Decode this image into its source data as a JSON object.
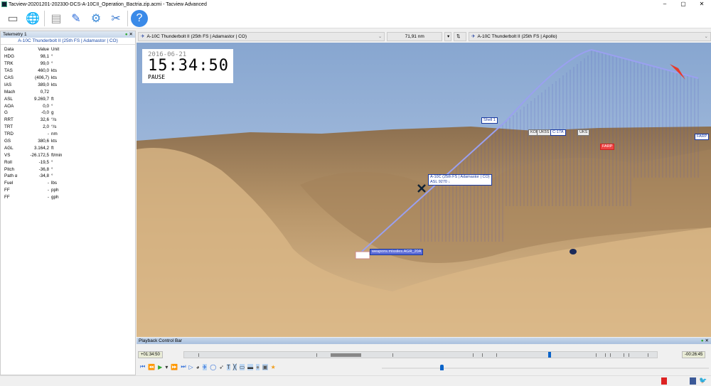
{
  "window": {
    "title": "Tacview-20201201-202330-DCS-A-10CII_Operation_Bactria.zip.acmi - Tacview Advanced"
  },
  "toolbar": {
    "icons": [
      "usb-drive-icon",
      "globe-icon",
      "document-icon",
      "notepad-edit-icon",
      "gear-icon",
      "tools-icon",
      "help-icon"
    ]
  },
  "telemetry": {
    "title": "Telemetry 1",
    "object": "A-10C Thunderbolt II (25th FS | Adamastor | CO)",
    "headers": [
      "Data",
      "Value",
      "Unit"
    ],
    "rows": [
      [
        "HDG",
        "98,1",
        "°"
      ],
      [
        "TRK",
        "99,0",
        "°"
      ],
      [
        "TAS",
        "460,0",
        "kts"
      ],
      [
        "CAS",
        "(406,7)",
        "kts"
      ],
      [
        "IAS",
        "389,0",
        "kts"
      ],
      [
        "Mach",
        "0,72",
        ""
      ],
      [
        "ASL",
        "9.269,7",
        "ft"
      ],
      [
        "AOA",
        "0,0",
        "°"
      ],
      [
        "G",
        "-0,0",
        "g"
      ],
      [
        "RRT",
        "32,6",
        "°/s"
      ],
      [
        "TRT",
        "2,0",
        "°/s"
      ],
      [
        "TRD",
        "-",
        "nm"
      ],
      [
        "GS",
        "380,6",
        "kts"
      ],
      [
        "AGL",
        "3.164,2",
        "ft"
      ],
      [
        "VS",
        "-26.172,5",
        "ft/min"
      ],
      [
        "Roll",
        "-19,5",
        "°"
      ],
      [
        "Pitch",
        "-36,8",
        "°"
      ],
      [
        "Path α",
        "-34,8",
        "°"
      ],
      [
        "Fuel",
        "-",
        "lbs"
      ],
      [
        "FF",
        "-",
        "pph"
      ],
      [
        "FF",
        "-",
        "gph"
      ]
    ]
  },
  "selectors": {
    "primary": "A-10C Thunderbolt II (25th FS | Adamastor | CO)",
    "distance": "71,91 nm",
    "secondary": "A-10C Thunderbolt II (25th FS | Apollo)"
  },
  "clock": {
    "date": "2016-06-21",
    "time": "15:34:50",
    "state": "PAUSE"
  },
  "labels": {
    "aircraft": "A-10C (25th FS | Adamastor | CO)",
    "aircraft_alt": "ASL 9270 ↓",
    "weapon": "weapons.missiles.AGR_20A",
    "shell": "Shell 1",
    "kob": "KOB",
    "uk5s": "UK5S",
    "c17": "C-17A",
    "uks": "UKS",
    "farp1": "FARP",
    "farp2": "FARP"
  },
  "playback": {
    "title": "Playback Control Bar",
    "start": "+01:34:50",
    "end": "-00:26:45",
    "progress": 0.18
  },
  "colors": {
    "accent": "#0a63c9",
    "track": "#6a6ae0"
  }
}
